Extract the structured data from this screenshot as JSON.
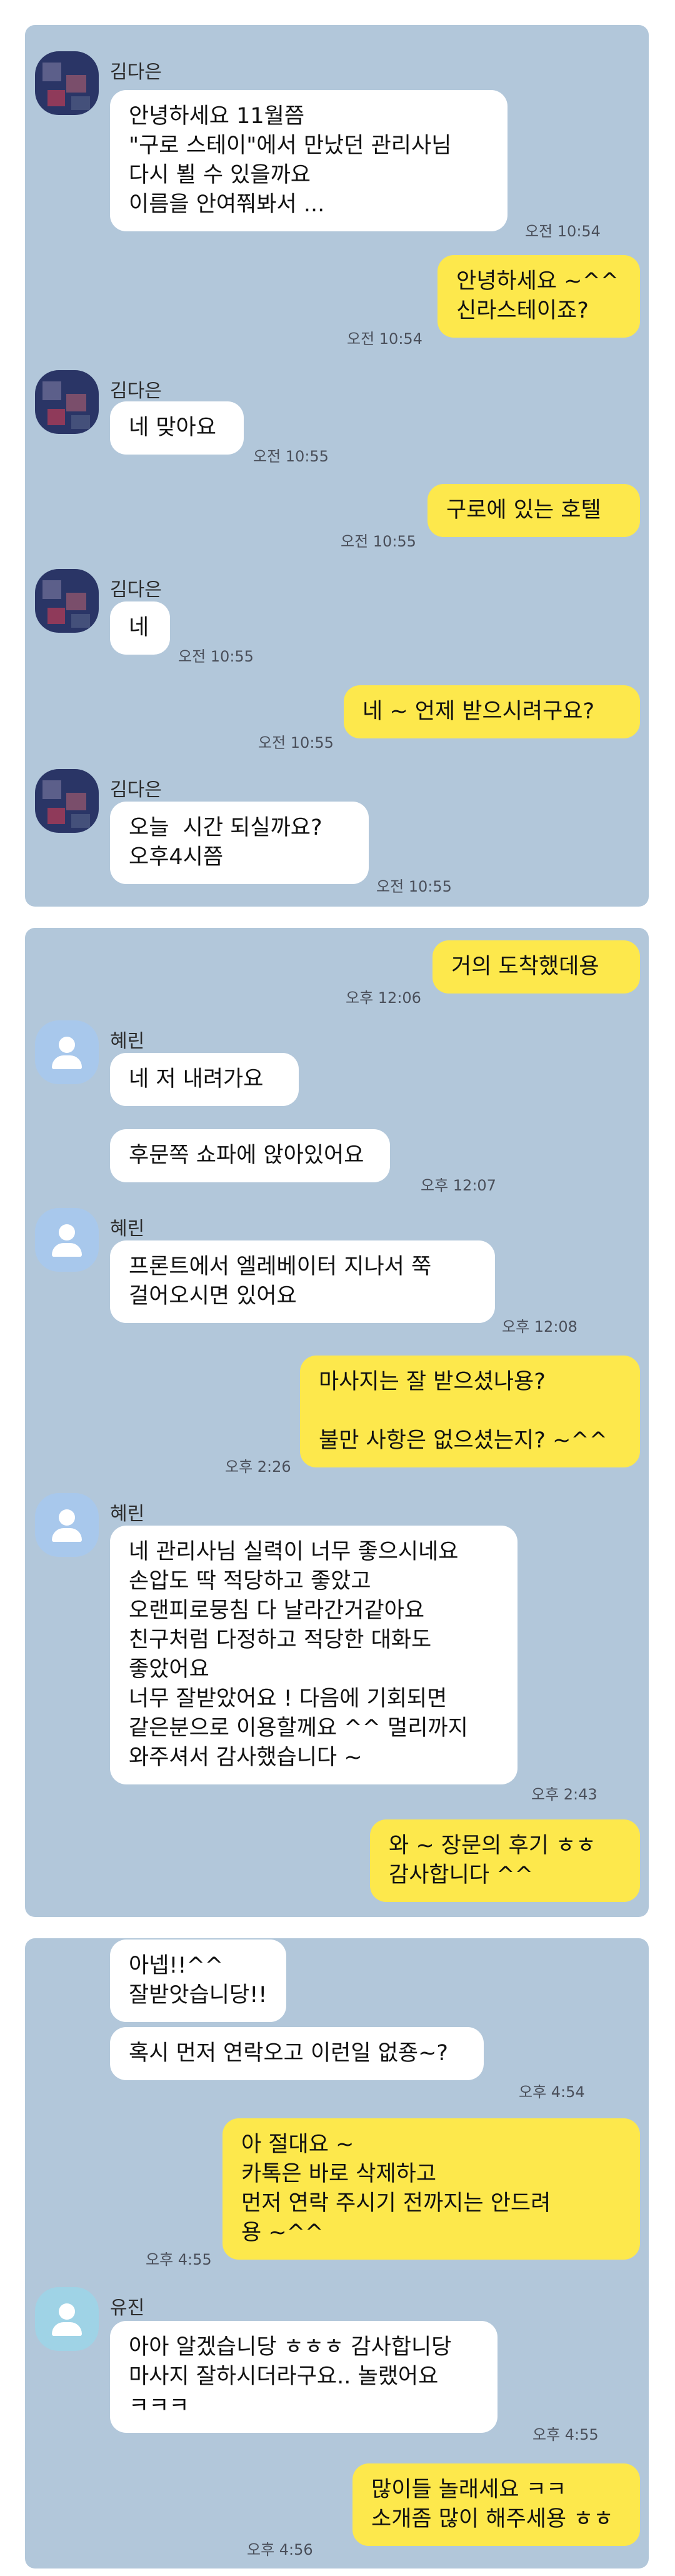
{
  "panel1": {
    "msg1": {
      "sender": "김다은",
      "text": "안녕하세요 11월쯤\n\"구로 스테이\"에서 만났던 관리사님\n다시 뵐 수 있을까요\n이름을 안여쭤봐서 ...",
      "time": "오전 10:54"
    },
    "msg2": {
      "text": "안녕하세요 ~^^\n신라스테이죠?",
      "time": "오전 10:54"
    },
    "msg3": {
      "sender": "김다은",
      "text": "네 맞아요",
      "time": "오전 10:55"
    },
    "msg4": {
      "text": "구로에 있는 호텔",
      "time": "오전 10:55"
    },
    "msg5": {
      "sender": "김다은",
      "text": "네",
      "time": "오전 10:55"
    },
    "msg6": {
      "text": "네 ~ 언제 받으시려구요?",
      "time": "오전 10:55"
    },
    "msg7": {
      "sender": "김다은",
      "text": "오늘  시간 되실까요?\n오후4시쯤",
      "time": "오전 10:55"
    }
  },
  "panel2": {
    "msg1": {
      "text": "거의 도착했데용",
      "time": "오후 12:06"
    },
    "msg2": {
      "sender": "혜린",
      "text": "네 저 내려가요"
    },
    "msg3": {
      "text": "후문쪽 쇼파에 앉아있어요",
      "time": "오후 12:07"
    },
    "msg4": {
      "sender": "혜린",
      "text": "프론트에서 엘레베이터 지나서 쭉\n걸어오시면 있어요",
      "time": "오후 12:08"
    },
    "msg5": {
      "text": "마사지는 잘 받으셨나용?\n\n불만 사항은 없으셨는지? ~^^",
      "time": "오후 2:26"
    },
    "msg6": {
      "sender": "혜린",
      "text": "네 관리사님 실력이 너무 좋으시네요\n손압도 딱 적당하고 좋았고\n오랜피로뭉침 다 날라간거같아요\n친구처럼 다정하고 적당한 대화도\n좋았어요\n너무 잘받았어요 ! 다음에 기회되면\n같은분으로 이용할께요 ^^ 멀리까지\n와주셔서 감사했습니다 ~",
      "time": "오후 2:43"
    },
    "msg7": {
      "text": "와 ~ 장문의 후기 ㅎㅎ\n감사합니다 ^^"
    }
  },
  "panel3": {
    "msg1": {
      "text": "아넵!!^^\n잘받앗습니당!!"
    },
    "msg2": {
      "text": "혹시 먼저 연락오고 이런일 없죵~?",
      "time": "오후 4:54"
    },
    "msg3": {
      "text": "아 절대요 ~\n카톡은 바로 삭제하고\n먼저 연락 주시기 전까지는 안드려\n용 ~^^",
      "time": "오후 4:55"
    },
    "msg4": {
      "sender": "유진",
      "text": "아아 알겠습니당 ㅎㅎㅎ 감사합니당\n마사지 잘하시더라구요.. 놀랬어요\nㅋㅋㅋ",
      "time": "오후 4:55"
    },
    "msg5": {
      "text": "많이들 놀래세요 ㅋㅋ\n소개좀 많이 해주세용 ㅎㅎ",
      "time": "오후 4:56"
    }
  }
}
